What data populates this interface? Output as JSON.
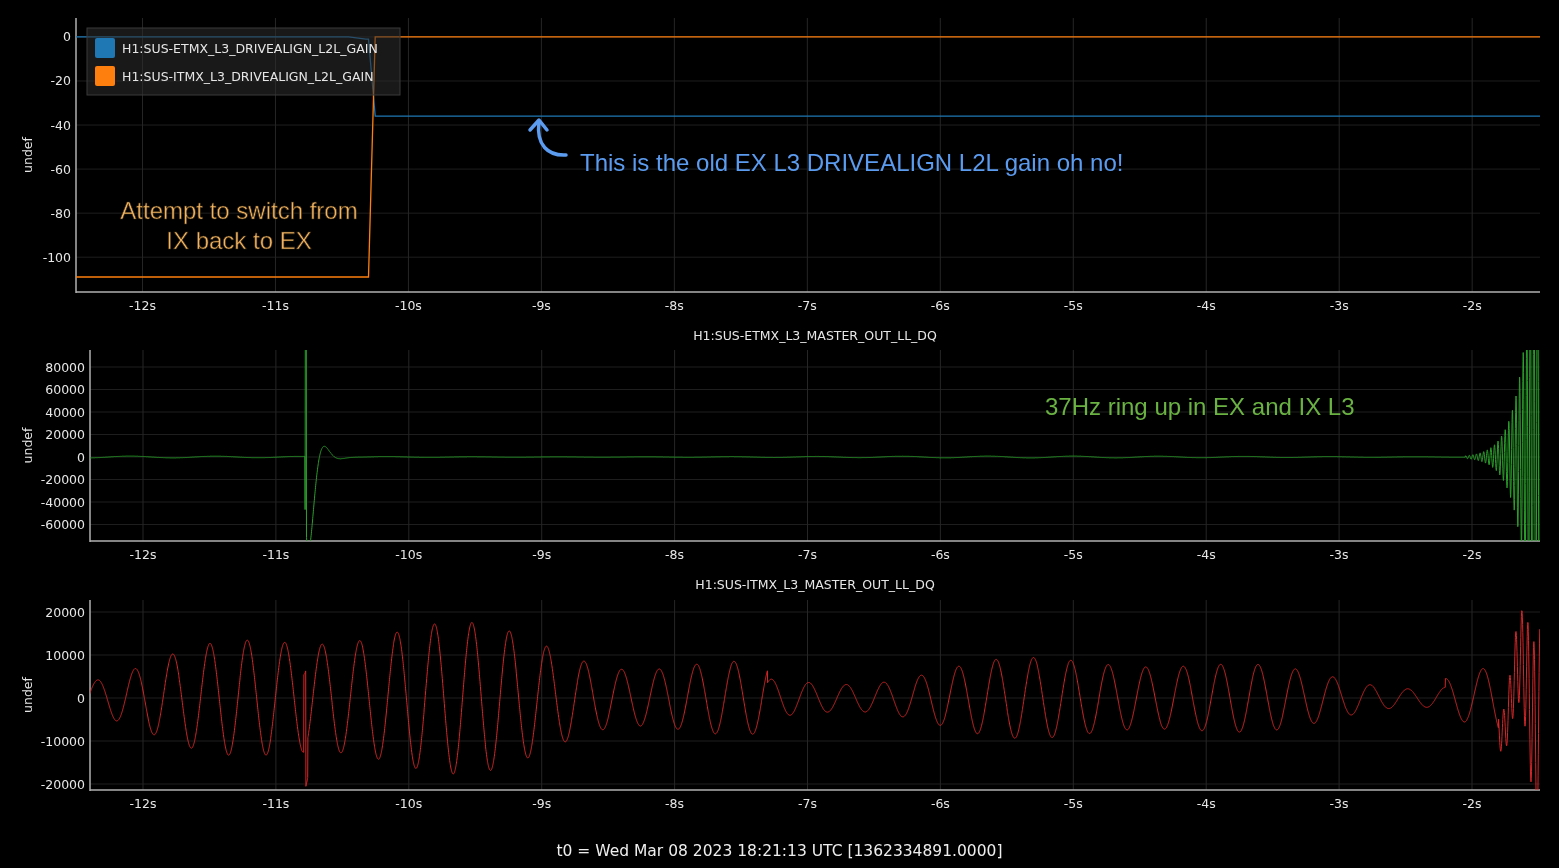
{
  "plots": [
    {
      "annotations": [
        {
          "kind": "arrow-note",
          "text": "This is the old EX L3 DRIVEALIGN L2L gain oh no!",
          "color": "#5b9cf0"
        },
        {
          "kind": "note",
          "lines": [
            "Attempt to switch from",
            "IX back to EX"
          ],
          "color": "#f2b463"
        }
      ],
      "chart_data": {
        "type": "line",
        "ylabel": "undef",
        "grid": true,
        "legend": true,
        "x": [
          -12.5,
          -10.45,
          -10.32,
          -10.3,
          -10.25,
          -1.49
        ],
        "series": [
          {
            "name": "H1:SUS-ETMX_L3_DRIVEALIGN_L2L_GAIN",
            "color": "#1f77b4",
            "values": [
              0,
              0,
              -1,
              -1,
              -36,
              -36
            ]
          },
          {
            "name": "H1:SUS-ITMX_L3_DRIVEALIGN_L2L_GAIN",
            "color": "#ff7f0e",
            "values": [
              -109,
              -109,
              -109,
              -109,
              0,
              0
            ]
          }
        ],
        "xlim": [
          -12.5,
          -1.49
        ],
        "ylim": [
          -115.8,
          8.6
        ],
        "xticks": [
          {
            "value": -12,
            "label": "-12s"
          },
          {
            "value": -11,
            "label": "-11s"
          },
          {
            "value": -10,
            "label": "-10s"
          },
          {
            "value": -9,
            "label": "-9s"
          },
          {
            "value": -8,
            "label": "-8s"
          },
          {
            "value": -7,
            "label": "-7s"
          },
          {
            "value": -6,
            "label": "-6s"
          },
          {
            "value": -5,
            "label": "-5s"
          },
          {
            "value": -4,
            "label": "-4s"
          },
          {
            "value": -3,
            "label": "-3s"
          },
          {
            "value": -2,
            "label": "-2s"
          }
        ],
        "yticks": [
          0,
          -20,
          -40,
          -60,
          -80,
          -100
        ]
      }
    },
    {
      "title": "H1:SUS-ETMX_L3_MASTER_OUT_LL_DQ",
      "ylabel": "undef",
      "color": "#2ca02c",
      "yticks": [
        "80000",
        "60000",
        "40000",
        "20000",
        "0",
        "-20000",
        "-40000",
        "-60000"
      ],
      "xticks": [
        "-12s",
        "-11s",
        "-10s",
        "-9s",
        "-8s",
        "-7s",
        "-6s",
        "-5s",
        "-4s",
        "-3s",
        "-2s"
      ],
      "annotations": [
        {
          "kind": "note",
          "lines": [
            "37Hz ring up in EX and IX L3"
          ],
          "color": "#6ab343"
        }
      ]
    },
    {
      "title": "H1:SUS-ITMX_L3_MASTER_OUT_LL_DQ",
      "ylabel": "undef",
      "color": "#d62728",
      "yticks": [
        "20000",
        "10000",
        "0",
        "-10000",
        "-20000"
      ],
      "xticks": [
        "-12s",
        "-11s",
        "-10s",
        "-9s",
        "-8s",
        "-7s",
        "-6s",
        "-5s",
        "-4s",
        "-3s",
        "-2s"
      ]
    }
  ],
  "footer": "t0 = Wed Mar 08 2023 18:21:13 UTC [1362334891.0000]"
}
